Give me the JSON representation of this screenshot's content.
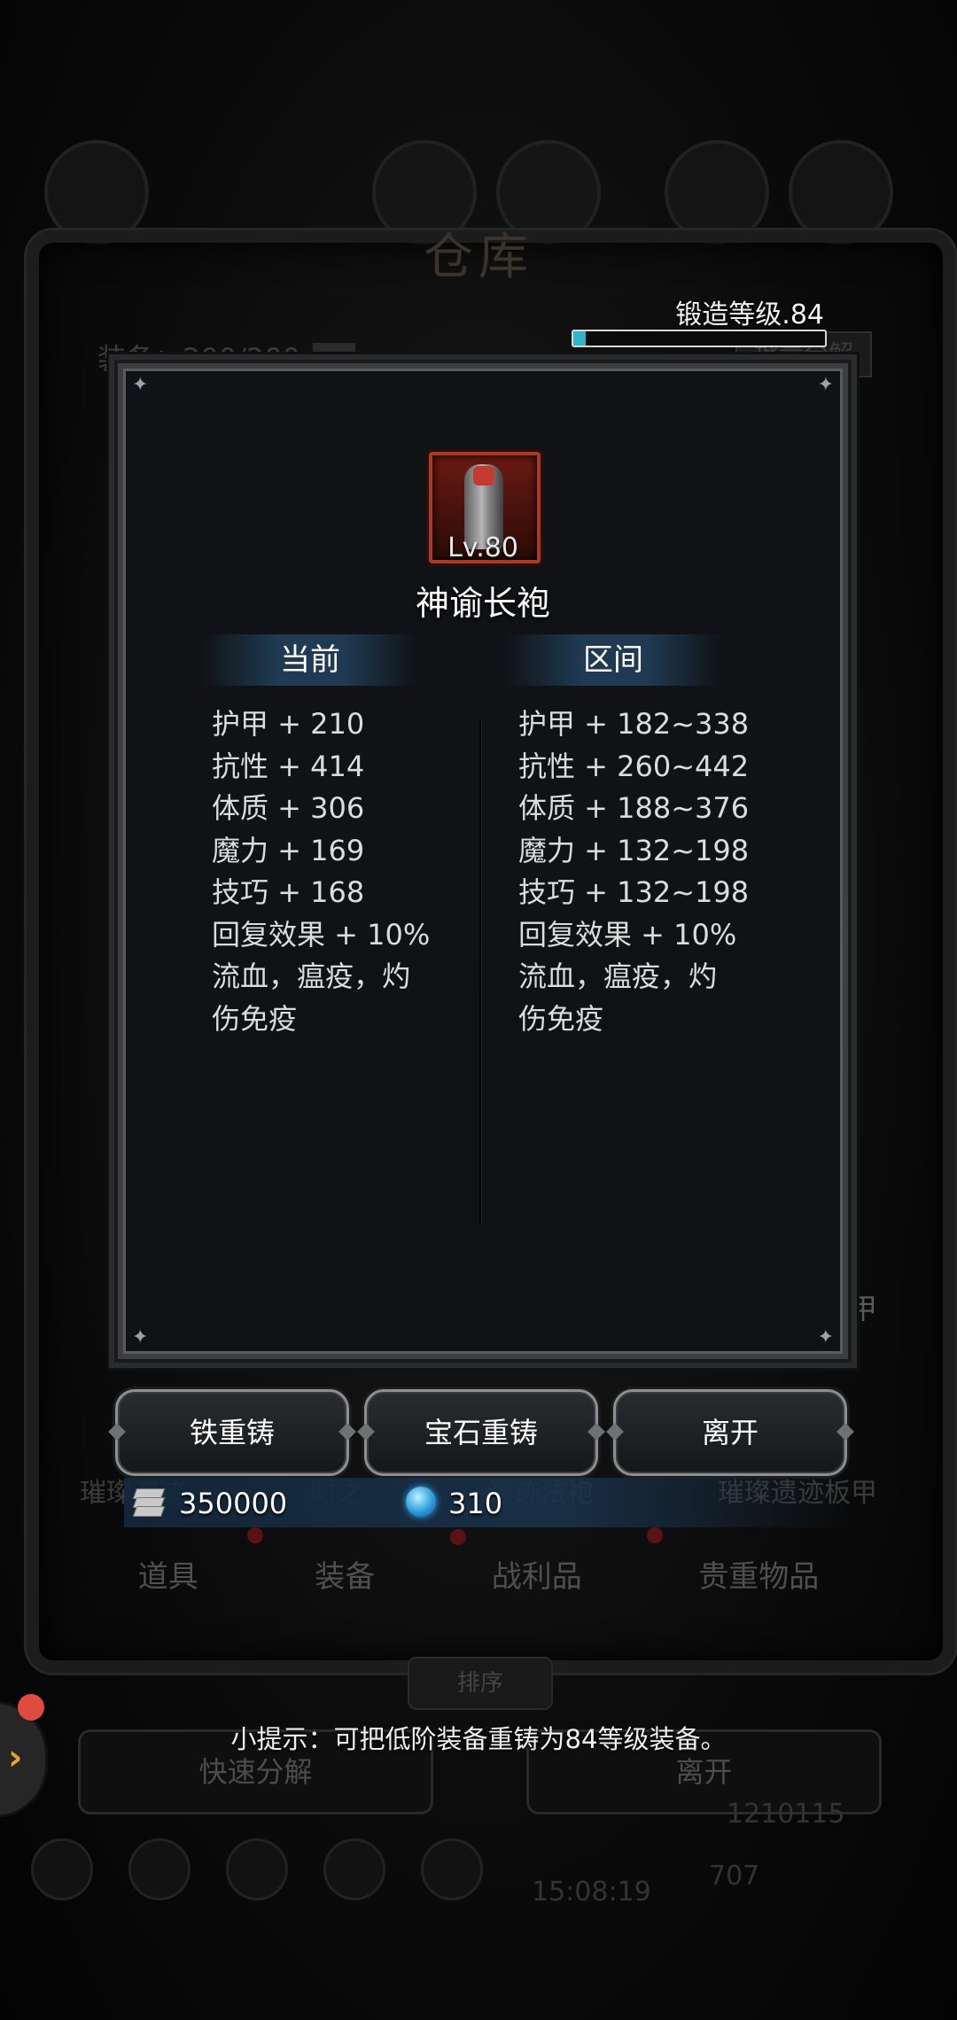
{
  "background": {
    "title": "仓库",
    "storage_label": "装备：200/200",
    "decompose_btn": "批量分解",
    "right_letter": "甲",
    "item_names": [
      "璀璨遗迹",
      "时之",
      "遗迹法袍",
      "璀璨遗迹板甲"
    ],
    "tabs": [
      "道具",
      "装备",
      "战利品",
      "贵重物品"
    ],
    "sort_btn": "排序",
    "quick_decompose_btn": "快速分解",
    "leave_btn": "离开",
    "time": "15:08:19",
    "gold": "1210115",
    "gems": "707"
  },
  "forge": {
    "label": "锻造等级.84",
    "progress": 0.05
  },
  "dialog": {
    "item_level": "Lv.80",
    "item_name": "神谕长袍",
    "current_header": "当前",
    "range_header": "区间",
    "current_stats": [
      "护甲 + 210",
      "抗性 + 414",
      "体质 + 306",
      "魔力 + 169",
      "技巧 + 168",
      "回复效果 + 10%",
      "流血，瘟疫，灼伤免疫"
    ],
    "range_stats": [
      "护甲 + 182~338",
      "抗性 + 260~442",
      "体质 + 188~376",
      "魔力 + 132~198",
      "技巧 + 132~198",
      "回复效果 + 10%",
      "流血，瘟疫，灼伤免疫"
    ]
  },
  "actions": {
    "iron_reforge": "铁重铸",
    "gem_reforge": "宝石重铸",
    "leave": "离开"
  },
  "currency": {
    "silver": "350000",
    "gems": "310"
  },
  "tip": "小提示：可把低阶装备重铸为84等级装备。",
  "colors": {
    "forge_fill": "#2fb7c9",
    "dialog_bg": "#101215",
    "header_band": "#1f3a52",
    "item_border": "#a93a2a"
  }
}
